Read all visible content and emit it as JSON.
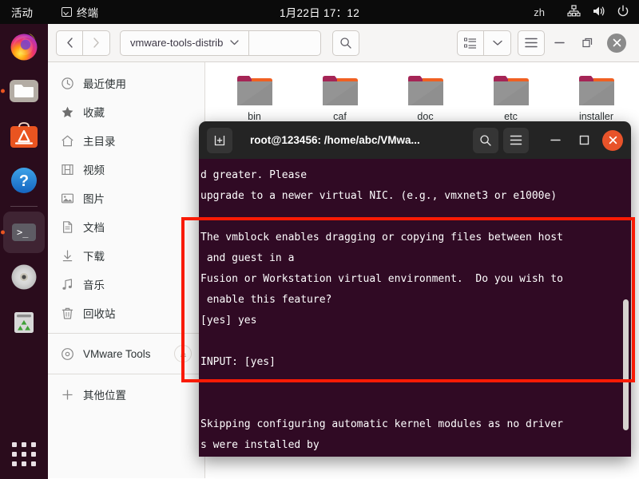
{
  "topbar": {
    "activities": "活动",
    "app_name": "终端",
    "app_icon": "terminal-icon",
    "clock": "1月22日 17：12",
    "input_method": "zh",
    "icons": [
      "network-icon",
      "volume-icon",
      "power-icon"
    ]
  },
  "dock": {
    "items": [
      {
        "name": "firefox",
        "icon": "firefox-icon",
        "running": false,
        "active": false
      },
      {
        "name": "files",
        "icon": "files-icon",
        "running": true,
        "active": false
      },
      {
        "name": "ubuntu-software",
        "icon": "ubuntu-software-icon",
        "running": false,
        "active": false
      },
      {
        "name": "help",
        "icon": "help-icon",
        "running": false,
        "active": false
      },
      {
        "name": "terminal",
        "icon": "terminal-icon",
        "running": true,
        "active": true
      },
      {
        "name": "disc",
        "icon": "disc-icon",
        "running": false,
        "active": false
      },
      {
        "name": "trash",
        "icon": "trash-icon",
        "running": false,
        "active": false
      }
    ],
    "show_apps_label": "show-applications"
  },
  "file_manager": {
    "back_label": "‹",
    "forward_label": "›",
    "path_label": "vmware-tools-distrib",
    "path_dropdown_icon": "chevron-down-icon",
    "search_icon": "search-icon",
    "view_list_icon": "list-view-icon",
    "view_dropdown_icon": "chevron-down-icon",
    "menu_icon": "hamburger-menu-icon",
    "minimize_icon": "minimize-icon",
    "maximize_icon": "maximize-icon",
    "close_icon": "close-icon",
    "sidebar": {
      "items": [
        {
          "label": "最近使用",
          "icon": "clock-icon"
        },
        {
          "label": "收藏",
          "icon": "star-icon"
        },
        {
          "label": "主目录",
          "icon": "home-icon"
        },
        {
          "label": "视频",
          "icon": "video-icon"
        },
        {
          "label": "图片",
          "icon": "image-icon"
        },
        {
          "label": "文档",
          "icon": "document-icon"
        },
        {
          "label": "下载",
          "icon": "download-icon"
        },
        {
          "label": "音乐",
          "icon": "music-icon"
        },
        {
          "label": "回收站",
          "icon": "trash-icon"
        }
      ],
      "mount": {
        "label": "VMware Tools",
        "icon": "disc-icon",
        "eject_icon": "eject-icon"
      },
      "other_locations": {
        "label": "其他位置",
        "icon": "plus-icon"
      }
    },
    "folders": [
      {
        "name": "bin"
      },
      {
        "name": "caf"
      },
      {
        "name": "doc"
      },
      {
        "name": "etc"
      },
      {
        "name": "installer"
      }
    ]
  },
  "terminal": {
    "title": "root@123456: /home/abc/VMwa...",
    "new_tab_icon": "new-tab-icon",
    "search_icon": "search-icon",
    "menu_icon": "hamburger-menu-icon",
    "minimize_icon": "minimize-icon",
    "maximize_icon": "maximize-icon",
    "close_icon": "close-icon",
    "lines": [
      "d greater. Please",
      "upgrade to a newer virtual NIC. (e.g., vmxnet3 or e1000e)",
      "",
      "The vmblock enables dragging or copying files between host",
      " and guest in a",
      "Fusion or Workstation virtual environment.  Do you wish to",
      " enable this feature?",
      "[yes] yes",
      "",
      "INPUT: [yes]",
      "",
      "",
      "Skipping configuring automatic kernel modules as no driver",
      "s were installed by"
    ]
  },
  "annotation": {
    "highlight_color": "#f91b05",
    "shape": "rectangle"
  }
}
